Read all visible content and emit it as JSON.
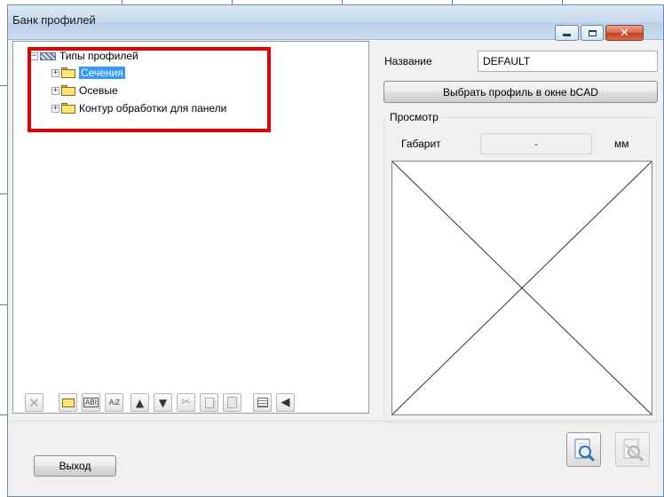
{
  "window": {
    "title": "Банк профилей"
  },
  "tree": {
    "root": "Типы профилей",
    "items": [
      {
        "label": "Сечения",
        "selected": true
      },
      {
        "label": "Осевые",
        "selected": false
      },
      {
        "label": "Контур обработки для панели",
        "selected": false
      }
    ]
  },
  "toolbar": {
    "icons": [
      "delete-icon",
      "new-folder-icon",
      "rename-icon",
      "sort-az-icon",
      "move-up-icon",
      "move-down-icon",
      "cut-icon",
      "copy-icon",
      "paste-icon",
      "import-icon",
      "arrow-left-icon"
    ],
    "rename_glyph": "ABI",
    "sort_glyph": "A↓Z"
  },
  "name_row": {
    "label": "Название",
    "value": "DEFAULT"
  },
  "pick_button": {
    "label": "Выбрать профиль в окне bCAD"
  },
  "preview_group": {
    "title": "Просмотр",
    "gabarit_label": "Габарит",
    "gabarit_value": "-",
    "unit": "мм"
  },
  "footer": {
    "exit_label": "Выход"
  },
  "colors": {
    "selection": "#3399ff",
    "highlight_frame": "#e00000"
  }
}
